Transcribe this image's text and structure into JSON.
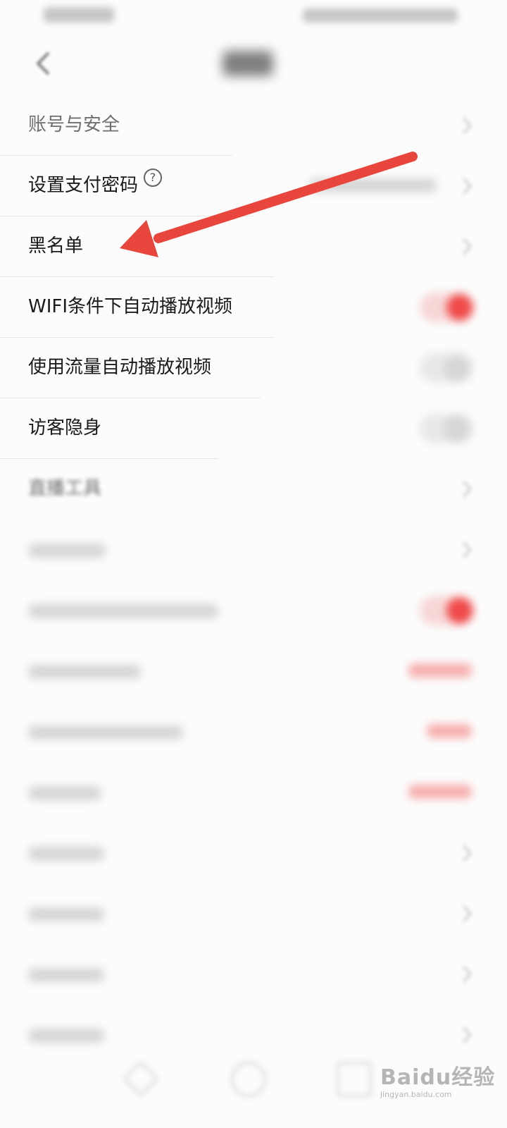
{
  "settings": {
    "items": [
      {
        "label": "账号与安全",
        "control": "chevron"
      },
      {
        "label": "设置支付密码",
        "control": "chevron",
        "help": "?"
      },
      {
        "label": "黑名单",
        "control": "chevron"
      },
      {
        "label": "WIFI条件下自动播放视频",
        "control": "toggle",
        "on": true
      },
      {
        "label": "使用流量自动播放视频",
        "control": "toggle",
        "on": false
      },
      {
        "label": "访客隐身",
        "control": "toggle",
        "on": false
      },
      {
        "label": "直播工具",
        "control": "chevron"
      }
    ]
  },
  "annotation": {
    "color": "#e8463c"
  },
  "watermark": {
    "logo": "Baidu经验",
    "url": "jingyan.baidu.com"
  }
}
